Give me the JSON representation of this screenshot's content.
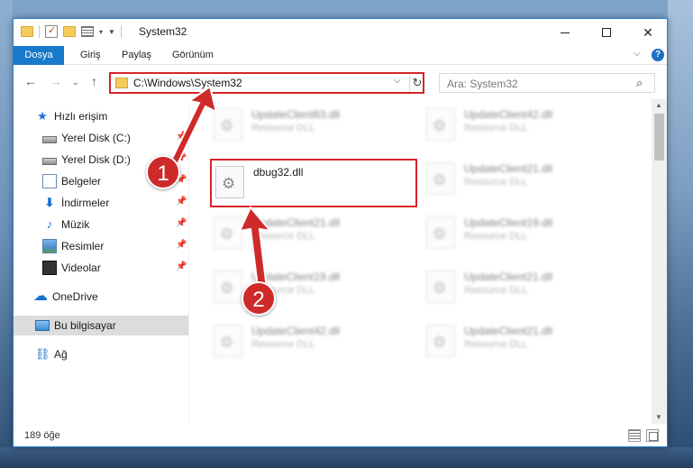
{
  "window": {
    "title": "System32"
  },
  "quick_access_toolbar": {
    "dropdown_glyph": "▾",
    "customize_glyph": "▼"
  },
  "window_controls": {
    "close_glyph": "✕"
  },
  "ribbon": {
    "file_tab": "Dosya",
    "tabs": [
      "Giriş",
      "Paylaş",
      "Görünüm"
    ],
    "expand_glyph": "⌵",
    "help_glyph": "?"
  },
  "navigation": {
    "back_glyph": "←",
    "forward_glyph": "→",
    "recent_glyph": "⌄",
    "up_glyph": "↑",
    "address": "C:\\Windows\\System32",
    "address_dropdown_glyph": "⌵",
    "refresh_glyph": "↻",
    "search_placeholder": "Ara: System32",
    "search_icon_glyph": "⌕"
  },
  "sidebar": {
    "items": [
      {
        "label": "Hızlı erişim",
        "icon": "star-icon",
        "glyph": "★"
      },
      {
        "label": "Yerel Disk (C:)",
        "icon": "drive-icon",
        "pinned": true
      },
      {
        "label": "Yerel Disk (D:)",
        "icon": "drive-icon",
        "pinned": true
      },
      {
        "label": "Belgeler",
        "icon": "document-icon",
        "pinned": true
      },
      {
        "label": "İndirmeler",
        "icon": "download-icon",
        "glyph": "⬇",
        "pinned": true
      },
      {
        "label": "Müzik",
        "icon": "music-icon",
        "glyph": "♪",
        "pinned": true
      },
      {
        "label": "Resimler",
        "icon": "pictures-icon",
        "pinned": true
      },
      {
        "label": "Videolar",
        "icon": "videos-icon",
        "pinned": true
      },
      {
        "label": "OneDrive",
        "icon": "cloud-icon",
        "glyph": "☁"
      },
      {
        "label": "Bu bilgisayar",
        "icon": "computer-icon",
        "selected": true
      },
      {
        "label": "Ağ",
        "icon": "network-icon",
        "glyph": "⛓"
      }
    ],
    "pin_glyph": "📌"
  },
  "files": [
    {
      "name": "UpdateClient63.dll",
      "type": "Resource DLL",
      "blurred": true
    },
    {
      "name": "UpdateClient42.dll",
      "type": "Resource DLL",
      "blurred": true
    },
    {
      "name": "dbug32.dll",
      "type": "",
      "blurred": false,
      "highlighted": true
    },
    {
      "name": "UpdateClient21.dll",
      "type": "Resource DLL",
      "blurred": true
    },
    {
      "name": "UpdateClient21.dll",
      "type": "Resource DLL",
      "blurred": true
    },
    {
      "name": "UpdateClient19.dll",
      "type": "Resource DLL",
      "blurred": true
    },
    {
      "name": "UpdateClient19.dll",
      "type": "Resource DLL",
      "blurred": true
    },
    {
      "name": "UpdateClient21.dll",
      "type": "Resource DLL",
      "blurred": true
    },
    {
      "name": "UpdateClient42.dll",
      "type": "Resource DLL",
      "blurred": true
    },
    {
      "name": "UpdateClient21.dll",
      "type": "Resource DLL",
      "blurred": true
    }
  ],
  "scrollbar": {
    "up_glyph": "▲",
    "down_glyph": "▼"
  },
  "status": {
    "item_count": "189 öğe"
  },
  "annotations": {
    "step1": "1",
    "step2": "2"
  },
  "colors": {
    "accent": "#1979ca",
    "highlight": "#d8232a",
    "annotation": "#cf2a2a"
  }
}
